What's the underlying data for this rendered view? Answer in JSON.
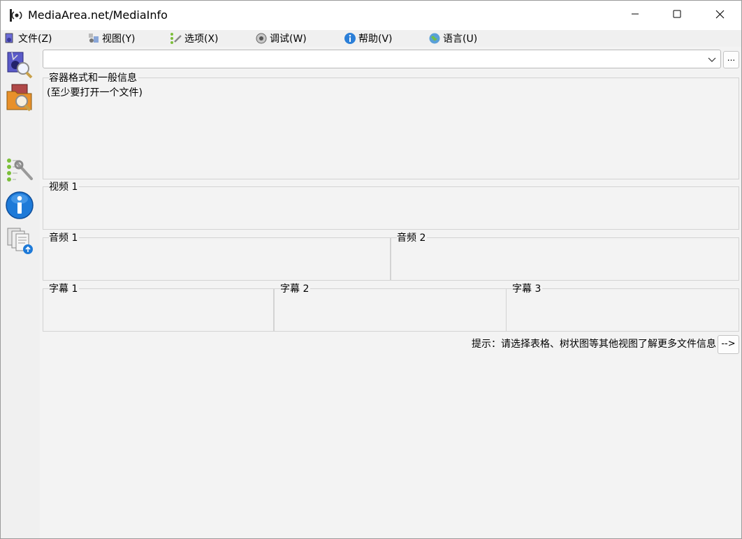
{
  "window": {
    "title": "MediaArea.net/MediaInfo"
  },
  "titlebar": {
    "minimize_icon": "minimize-icon",
    "maximize_icon": "maximize-icon",
    "close_icon": "close-icon"
  },
  "menu": {
    "items": [
      {
        "label": "文件(Z)",
        "icon": "file-icon"
      },
      {
        "label": "视图(Y)",
        "icon": "view-icon"
      },
      {
        "label": "选项(X)",
        "icon": "options-icon"
      },
      {
        "label": "调试(W)",
        "icon": "debug-icon"
      },
      {
        "label": "帮助(V)",
        "icon": "help-icon"
      },
      {
        "label": "语言(U)",
        "icon": "language-icon"
      }
    ]
  },
  "sidebar": {
    "buttons": [
      {
        "icon": "open-file-icon"
      },
      {
        "icon": "open-folder-icon"
      },
      {
        "icon": "preferences-icon"
      },
      {
        "icon": "info-icon"
      },
      {
        "icon": "export-icon"
      }
    ]
  },
  "file_selector": {
    "value": "",
    "browse_label": "..."
  },
  "sections": {
    "general": {
      "label": "容器格式和一般信息",
      "text": "(至少要打开一个文件)"
    },
    "video1": {
      "label": "视频 1"
    },
    "audio1": {
      "label": "音频 1"
    },
    "audio2": {
      "label": "音频 2"
    },
    "text1": {
      "label": "字幕 1"
    },
    "text2": {
      "label": "字幕 2"
    },
    "text3": {
      "label": "字幕 3"
    }
  },
  "hint": {
    "text": "提示：请选择表格、树状图等其他视图了解更多文件信息",
    "button_label": "-->"
  },
  "colors": {
    "window_bg": "#f0f0f0",
    "content_bg": "#f3f3f3",
    "group_border": "#d3d3d3",
    "info_blue": "#1e7ad8"
  }
}
